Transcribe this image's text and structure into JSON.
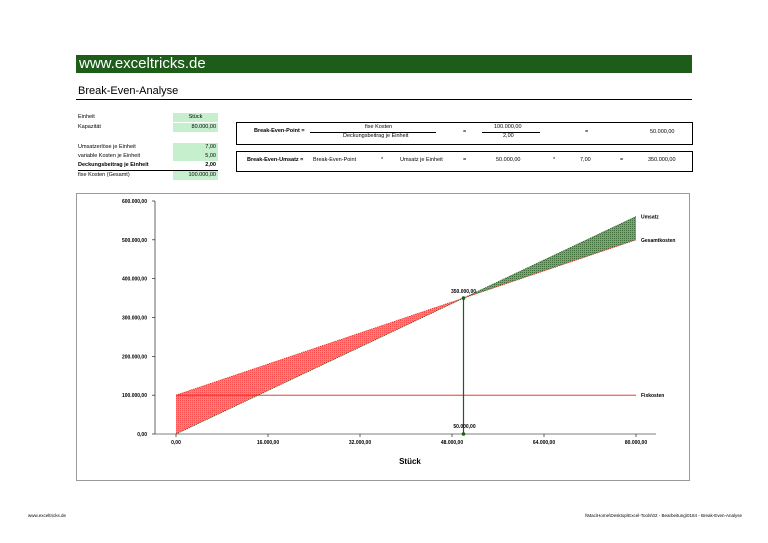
{
  "header": {
    "site": "www.exceltricks.de",
    "title": "Break-Even-Analyse"
  },
  "inputs": [
    {
      "label": "Einheit",
      "value": "Stück"
    },
    {
      "label": "Kapazität",
      "value": "80.000,00"
    },
    {
      "label": "Umsatzerlöse je Einheit",
      "value": "7,00"
    },
    {
      "label": "variable Kosten je Einheit",
      "value": "5,00"
    },
    {
      "label": "Deckungsbeitrag je Einheit",
      "value": "2,00"
    },
    {
      "label": "fixe Kosten (Gesamt)",
      "value": "100.000,00"
    }
  ],
  "bep": {
    "label": "Break-Even-Point =",
    "numerator": "fixe Kosten",
    "denominator": "Deckungsbeitrag je Einheit",
    "eq1": "=",
    "num_value": "100.000,00",
    "den_value": "2,00",
    "eq2": "=",
    "result": "50.000,00"
  },
  "beu": {
    "label": "Break-Even-Umsatz =",
    "term1": "Break-Even-Point",
    "op1": "*",
    "term2": "Umsatz je Einheit",
    "eq1": "=",
    "val1": "50.000,00",
    "op2": "*",
    "val2": "7,00",
    "eq2": "=",
    "result": "350.000,00"
  },
  "chart_data": {
    "type": "line",
    "xlabel": "Stück",
    "xlim": [
      0,
      80000
    ],
    "ylim": [
      0,
      600000
    ],
    "x_ticks": [
      "0,00",
      "16.000,00",
      "32.000,00",
      "48.000,00",
      "64.000,00",
      "80.000,00"
    ],
    "y_ticks": [
      "0,00",
      "100.000,00",
      "200.000,00",
      "300.000,00",
      "400.000,00",
      "500.000,00",
      "600.000,00"
    ],
    "series": [
      {
        "name": "Umsatz",
        "x": [
          0,
          80000
        ],
        "y": [
          0,
          560000
        ],
        "color": "#1e5c1a"
      },
      {
        "name": "Gesamtkosten",
        "x": [
          0,
          80000
        ],
        "y": [
          100000,
          500000
        ],
        "color": "#e0201a"
      },
      {
        "name": "Fixkosten",
        "x": [
          0,
          80000
        ],
        "y": [
          100000,
          100000
        ],
        "color": "#e0201a"
      }
    ],
    "break_even": {
      "x": 50000,
      "y": 350000,
      "label_point": "350.000,00",
      "label_x": "50.000,00"
    },
    "loss_fill": "#ff6666",
    "profit_fill": "#5a8c55"
  },
  "footer": {
    "left": "www.exceltricks.de",
    "right": "\\\\Mac\\Home\\Desktop\\Excel-Tools\\02 - Bearbeitung\\0184 - Break-Even-Analyse"
  }
}
